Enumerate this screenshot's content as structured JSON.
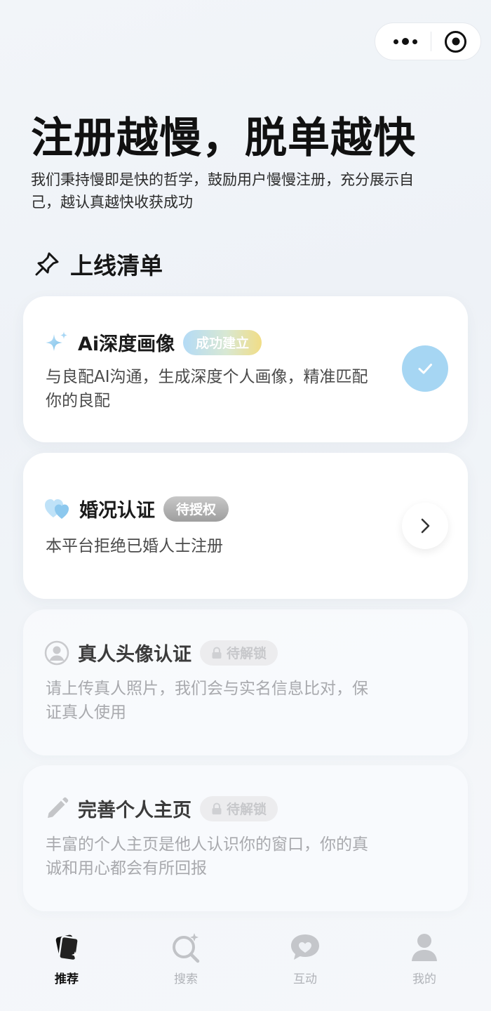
{
  "capsule": {
    "more_icon": "more-dots-icon",
    "close_icon": "target-icon"
  },
  "hero": {
    "title": "注册越慢，脱单越快",
    "description": "我们秉持慢即是快的哲学，鼓励用户慢慢注册，充分展示自己，越认真越快收获成功"
  },
  "section": {
    "title": "上线清单",
    "icon": "pin-icon"
  },
  "cards": [
    {
      "title": "Ai深度画像",
      "badge": "成功建立",
      "description": "与良配AI沟通，生成深度个人画像，精准匹配你的良配",
      "icon": "sparkle-icon",
      "status": "done"
    },
    {
      "title": "婚况认证",
      "badge": "待授权",
      "description": "本平台拒绝已婚人士注册",
      "icon": "hearts-icon",
      "status": "pending"
    },
    {
      "title": "真人头像认证",
      "badge": "待解锁",
      "description": "请上传真人照片，我们会与实名信息比对，保证真人使用",
      "icon": "user-circle-icon",
      "status": "locked"
    },
    {
      "title": "完善个人主页",
      "badge": "待解锁",
      "description": "丰富的个人主页是他人认识你的窗口，你的真诚和用心都会有所回报",
      "icon": "pencil-icon",
      "status": "locked"
    }
  ],
  "tabs": [
    {
      "label": "推荐",
      "icon": "cards-icon",
      "active": true
    },
    {
      "label": "搜索",
      "icon": "search-sparkle-icon",
      "active": false
    },
    {
      "label": "互动",
      "icon": "chat-heart-icon",
      "active": false
    },
    {
      "label": "我的",
      "icon": "person-icon",
      "active": false
    }
  ],
  "colors": {
    "accent_blue": "#a6d6f3",
    "badge_gradient": [
      "#b4dbf6",
      "#f1dd86"
    ],
    "tab_inactive": "#b0b3b8"
  }
}
